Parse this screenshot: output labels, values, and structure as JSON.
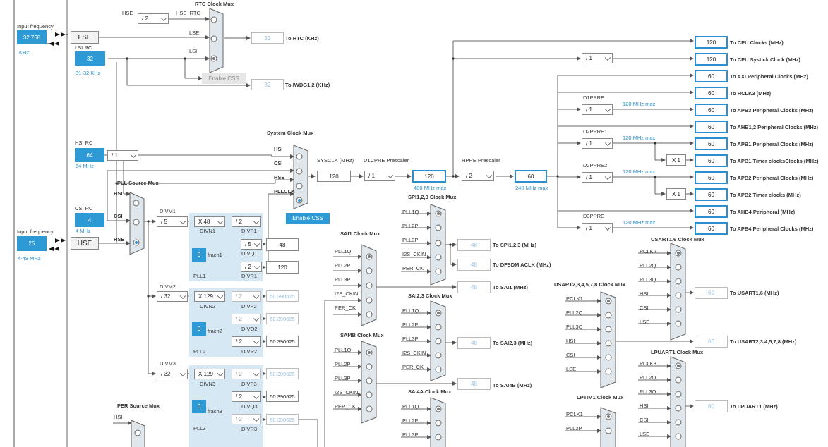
{
  "inputs": {
    "lse_input": {
      "label": "Input frequency",
      "value": "32.768",
      "unit": "KHz"
    },
    "hse_input": {
      "label": "Input frequency",
      "value": "25",
      "range": "4-48 MHz"
    }
  },
  "sources": {
    "lse": "LSE",
    "hse": "HSE",
    "lsi": {
      "label": "LSI RC",
      "value": "32",
      "range": "31-32 KHz"
    },
    "hsi": {
      "label": "HSI RC",
      "value": "64",
      "range": "64 MHz"
    },
    "csi": {
      "label": "CSI RC",
      "value": "4",
      "range": "4 MHz"
    }
  },
  "rtc": {
    "title": "RTC Clock Mux",
    "hse_label": "HSE",
    "hse_div": "/ 2",
    "hse_rtc": "HSE_RTC",
    "lse": "LSE",
    "lsi": "LSI",
    "enable_css": "Enable CSS",
    "rtc_value": "32",
    "rtc_label": "To RTC (KHz)",
    "iwdg_value": "32",
    "iwdg_label": "To IWDG1,2 (KHz)"
  },
  "hsi_div": "/ 1",
  "sysmux": {
    "title": "System Clock Mux",
    "hsi": "HSI",
    "csi": "CSI",
    "hse": "HSE",
    "pllclk": "PLLCLK",
    "enable_css": "Enable CSS"
  },
  "sysclk": {
    "label": "SYSCLK (MHz)",
    "value": "120"
  },
  "d1cpre": {
    "label": "D1CPRE Prescaler",
    "value": "/ 1",
    "out": "120",
    "max": "480 MHz max"
  },
  "hpre": {
    "label": "HPRE Prescaler",
    "value": "/ 2",
    "out": "60",
    "max": "240 MHz max"
  },
  "cpu_systick_div": "/ 1",
  "d1ppre": {
    "label": "D1PPRE",
    "value": "/ 1",
    "max": "120 MHz max"
  },
  "d2ppre1": {
    "label": "D2PPRE1",
    "value": "/ 1",
    "max": "120 MHz max"
  },
  "d2ppre2": {
    "label": "D2PPRE2",
    "value": "/ 1",
    "max": "120 MHz max"
  },
  "d3ppre": {
    "label": "D3PPRE",
    "value": "/ 1",
    "max": "120 MHz max"
  },
  "x1": "X 1",
  "outputs": [
    {
      "value": "120",
      "label": "To CPU Clocks (MHz)"
    },
    {
      "value": "120",
      "label": "To CPU Systick Clock (MHz)"
    },
    {
      "value": "60",
      "label": "To AXI Peripheral Clocks (MHz)"
    },
    {
      "value": "60",
      "label": "To HCLK3 (MHz)"
    },
    {
      "value": "60",
      "label": "To APB3 Peripheral Clocks (MHz)"
    },
    {
      "value": "60",
      "label": "To AHB1,2 Peripheral Clocks (MHz)"
    },
    {
      "value": "60",
      "label": "To APB1 Peripheral Clocks (MHz)"
    },
    {
      "value": "60",
      "label": "To APB1 Timer clocksClocks (MHz)"
    },
    {
      "value": "60",
      "label": "To APB2 Peripheral Clocks (MHz)"
    },
    {
      "value": "60",
      "label": "To APB2 Timer clocks (MHz)"
    },
    {
      "value": "60",
      "label": "To AHB4 Peripheral (MHz)"
    },
    {
      "value": "60",
      "label": "To APB4 Peripheral Clocks (MHz)"
    }
  ],
  "pllsrc": {
    "title": "PLL Source Mux",
    "hsi": "HSI",
    "csi": "CSI",
    "hse": "HSE"
  },
  "pll1": {
    "divm_label": "DIVM1",
    "divm": "/ 5",
    "divn": "X 48",
    "divn_label": "DIVN1",
    "divp": "/ 2",
    "divp_label": "DIVP1",
    "divq": "/ 5",
    "divq_label": "DIVQ1",
    "divq_out": "48",
    "divr": "/ 2",
    "divr_label": "DIVR1",
    "divr_out": "120",
    "frac": "0",
    "frac_label": "fracn1",
    "name": "PLL1"
  },
  "pll2": {
    "divm_label": "DIVM2",
    "divm": "/ 32",
    "divn": "X 129",
    "divn_label": "DIVN2",
    "divp": "/ 2",
    "divp_label": "DIVP2",
    "divp_out": "50.390625",
    "divq": "/ 2",
    "divq_label": "DIVQ2",
    "divq_out": "50.390625",
    "divr": "/ 2",
    "divr_label": "DIVR2",
    "divr_out": "50.390625",
    "frac": "0",
    "frac_label": "fracn2",
    "name": "PLL2"
  },
  "pll3": {
    "divm_label": "DIVM3",
    "divm": "/ 32",
    "divn": "X 129",
    "divn_label": "DIVN3",
    "divp": "/ 2",
    "divp_label": "DIVP3",
    "divp_out": "50.390625",
    "divq": "/ 2",
    "divq_label": "DIVQ3",
    "divq_out": "50.390625",
    "divr": "/ 2",
    "divr_label": "DIVR3",
    "divr_out": "50.390625",
    "frac": "0",
    "frac_label": "fracn3",
    "name": "PLL3"
  },
  "spi123": {
    "title": "SPI1,2,3 Clock Mux",
    "inputs": [
      "PLL1Q",
      "PLL2P",
      "PLL3P",
      "I2S_CKIN",
      "PER_CK"
    ],
    "out": "48",
    "label": "To SPI1,2,3 (MHz)"
  },
  "dfsdm": {
    "out": "48",
    "label": "To DFSDM ACLK (MHz)"
  },
  "sai1": {
    "title": "SAI1 Clock Mux",
    "inputs": [
      "PLL1Q",
      "PLL2P",
      "PLL3P",
      "I2S_CKIN",
      "PER_CK"
    ],
    "out": "48",
    "label": "To SAI1 (MHz)"
  },
  "sai23": {
    "title": "SAI2,3 Clock Mux",
    "inputs": [
      "PLL1Q",
      "PLL2P",
      "PLL3P",
      "I2S_CKIN",
      "PER_CK"
    ],
    "out": "48",
    "label": "To SAI2,3 (MHz)"
  },
  "sai4b": {
    "title": "SAI4B Clock Mux",
    "inputs": [
      "PLL1Q",
      "PLL2P",
      "PLL3P",
      "I2S_CKIN",
      "PER_CK"
    ],
    "out": "48",
    "label": "To SAI4B (MHz)"
  },
  "sai4a": {
    "title": "SAI4A Clock Mux",
    "inputs": [
      "PLL1Q",
      "PLL2P",
      "PLL3P"
    ]
  },
  "per": {
    "title": "PER Source Mux",
    "hsi": "HSI"
  },
  "usart16": {
    "title": "USART1,6 Clock Mux",
    "inputs": [
      "PCLK2",
      "PLL2Q",
      "PLL3Q",
      "HSI",
      "CSI",
      "LSE"
    ],
    "out": "60",
    "label": "To USART1,6 (MHz)"
  },
  "usart2": {
    "title": "USART2,3,4,5,7,8 Clock Mux",
    "inputs": [
      "PCLK1",
      "PLL2Q",
      "PLL3Q",
      "HSI",
      "CSI",
      "LSE"
    ],
    "out": "60",
    "label": "To USART2,3,4,5,7,8 (MHz)"
  },
  "lpuart1": {
    "title": "LPUART1 Clock Mux",
    "inputs": [
      "PCLK3",
      "PLL2Q",
      "PLL3Q",
      "HSI",
      "CSI",
      "LSE"
    ],
    "out": "60",
    "label": "To LPUART1 (MHz)"
  },
  "lptim1": {
    "title": "LPTIM1 Clock Mux",
    "inputs": [
      "PCLK1",
      "PLL2P"
    ]
  },
  "colors": {
    "accent": "#2d9ad6",
    "pll_bg": "#d7e8f5",
    "line": "#555555"
  }
}
